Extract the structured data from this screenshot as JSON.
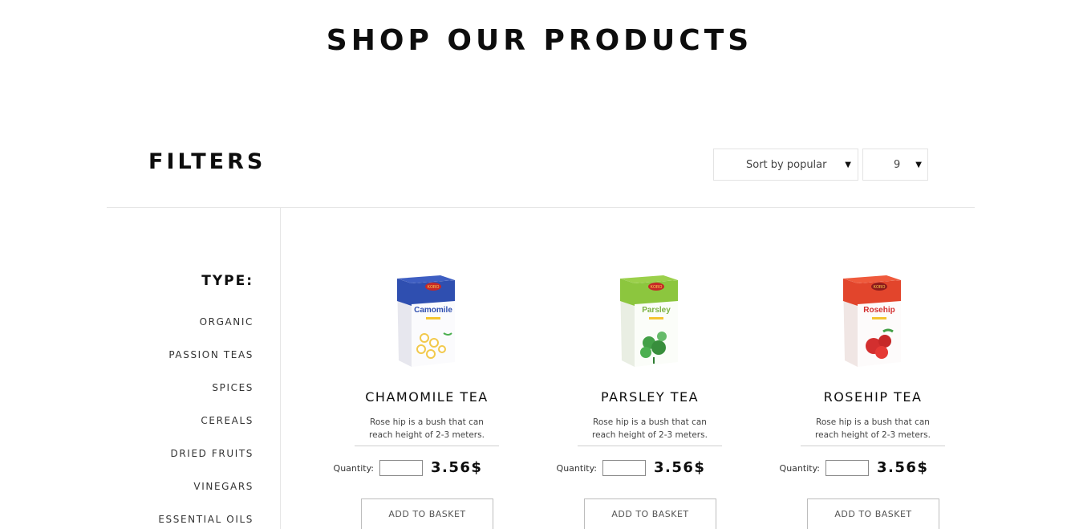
{
  "page_title": "SHOP OUR PRODUCTS",
  "filters": {
    "heading": "FILTERS",
    "sort_value": "Sort by popular",
    "count_value": "9",
    "caret": "▼"
  },
  "type_filter": {
    "heading": "TYPE:",
    "items": [
      "ORGANIC",
      "PASSION TEAS",
      "SPICES",
      "CEREALS",
      "DRIED FRUITS",
      "VINEGARS",
      "ESSENTIAL OILS"
    ]
  },
  "products": [
    {
      "name": "CHAMOMILE TEA",
      "brand": "KORO",
      "box_label": "Camomile",
      "desc_line1": "Rose hip is a bush that can",
      "desc_line2": "reach height of 2-3 meters.",
      "quantity_label": "Quantity:",
      "price": "3.56$",
      "button_label": "ADD TO BASKET",
      "accent_color": "#2f4fb0"
    },
    {
      "name": "PARSLEY TEA",
      "brand": "KORO",
      "box_label": "Parsley",
      "desc_line1": "Rose hip is a bush that can",
      "desc_line2": "reach height of 2-3 meters.",
      "quantity_label": "Quantity:",
      "price": "3.56$",
      "button_label": "ADD TO BASKET",
      "accent_color": "#8cc63e"
    },
    {
      "name": "ROSEHIP TEA",
      "brand": "KORO",
      "box_label": "Rosehip",
      "desc_line1": "Rose hip is a bush that can",
      "desc_line2": "reach height of 2-3 meters.",
      "quantity_label": "Quantity:",
      "price": "3.56$",
      "button_label": "ADD TO BASKET",
      "accent_color": "#e2452c"
    }
  ]
}
